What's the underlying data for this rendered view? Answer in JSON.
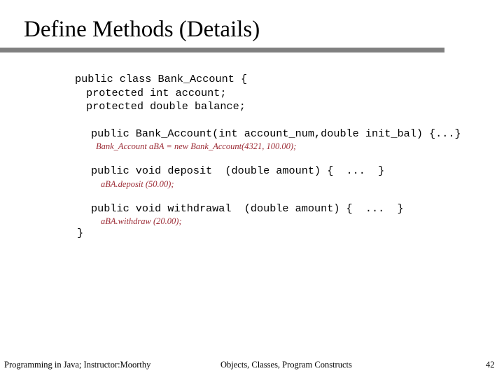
{
  "slide": {
    "title": "Define Methods (Details)",
    "page_number": "42",
    "rule_color": "#808080",
    "code_color": "#000000",
    "note_color": "#9c2b35"
  },
  "code": {
    "line1": "public class Bank_Account {",
    "line2": "protected int account;",
    "line3": "protected double balance;",
    "line4": "public Bank_Account(int account_num,double init_bal) {...}",
    "note1": "Bank_Account aBA = new Bank_Account(4321, 100.00);",
    "line5": "public void deposit  (double amount) {  ...  }",
    "note2": "aBA.deposit (50.00);",
    "line6": "public void withdrawal  (double amount) {  ...  }",
    "note3": "aBA.withdraw (20.00);",
    "line7": "}"
  },
  "footer": {
    "left": "Programming in Java; Instructor:Moorthy",
    "center": "Objects, Classes, Program Constructs"
  }
}
